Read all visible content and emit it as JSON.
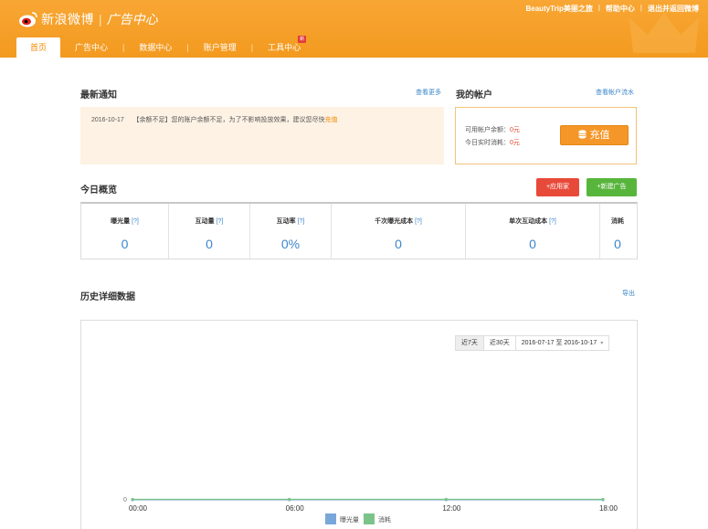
{
  "header": {
    "brand": "新浪微博",
    "sub": "广告中心",
    "top_links": [
      "BeautyTrip美丽之旅",
      "帮助中心",
      "退出并返回微博"
    ],
    "nav": [
      {
        "label": "首页",
        "active": true
      },
      {
        "label": "广告中心"
      },
      {
        "label": "数据中心"
      },
      {
        "label": "账户管理"
      },
      {
        "label": "工具中心",
        "badge": "新"
      }
    ]
  },
  "notice": {
    "title": "最新通知",
    "more": "查看更多",
    "date": "2016-10-17",
    "tag": "【余额不足】",
    "text": "您的账户余额不足，为了不影响投放效果，建议您尽快",
    "action": "充值"
  },
  "account": {
    "title": "我的帐户",
    "link": "查看帐户流水",
    "balance_label": "可用帐户余额：",
    "balance_value": "0元",
    "spend_label": "今日实时消耗：",
    "spend_value": "0元",
    "recharge": "充值"
  },
  "overview": {
    "title": "今日概览",
    "btn_app": "+应用家",
    "btn_new": "+新建广告",
    "stats": [
      {
        "label": "曝光量",
        "q": "[?]",
        "value": "0"
      },
      {
        "label": "互动量",
        "q": "[?]",
        "value": "0"
      },
      {
        "label": "互动率",
        "q": "[?]",
        "value": "0%"
      },
      {
        "label": "千次曝光成本",
        "q": "[?]",
        "value": "0"
      },
      {
        "label": "单次互动成本",
        "q": "[?]",
        "value": "0"
      },
      {
        "label": "消耗",
        "q": "",
        "value": "0"
      }
    ]
  },
  "history": {
    "title": "历史详细数据",
    "export": "导出",
    "ranges": [
      "近7天",
      "近30天"
    ],
    "date_range": "2016-07-17 至 2016-10-17"
  },
  "chart_data": {
    "type": "line",
    "x": [
      "00:00",
      "06:00",
      "12:00",
      "18:00"
    ],
    "y_tick": "0",
    "series": [
      {
        "name": "曝光量",
        "color": "#7aa7d9",
        "values": [
          0,
          0,
          0,
          0
        ]
      },
      {
        "name": "消耗",
        "color": "#7cc38a",
        "values": [
          0,
          0,
          0,
          0
        ]
      }
    ]
  },
  "colors": {
    "brand": "#f39a1f",
    "link": "#3b86c9",
    "red": "#e84a3a",
    "green": "#58b53c"
  }
}
